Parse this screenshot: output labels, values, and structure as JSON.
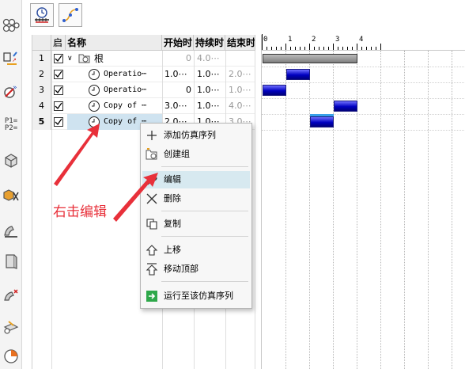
{
  "columns": {
    "enabled": "启",
    "name": "名称",
    "start": "开始时",
    "duration": "持续时",
    "end": "结束时"
  },
  "rows": [
    {
      "num": "1",
      "name": "根",
      "start": "0",
      "duration": "4.0⋯",
      "end": ""
    },
    {
      "num": "2",
      "name": "Operatio⋯",
      "start": "1.0⋯",
      "duration": "1.0⋯",
      "end": "2.0⋯"
    },
    {
      "num": "3",
      "name": "Operatio⋯",
      "start": "0",
      "duration": "1.0⋯",
      "end": "1.0⋯"
    },
    {
      "num": "4",
      "name": "Copy of ⋯",
      "start": "3.0⋯",
      "duration": "1.0⋯",
      "end": "4.0⋯"
    },
    {
      "num": "5",
      "name": "Copy of ⋯",
      "start": "2.0⋯",
      "duration": "1.0⋯",
      "end": "3.0⋯"
    }
  ],
  "ruler_labels": [
    "0",
    "1",
    "2",
    "3",
    "4"
  ],
  "context_menu": {
    "add_sequence": "添加仿真序列",
    "create_group": "创建组",
    "edit": "编辑",
    "delete": "删除",
    "copy": "复制",
    "move_up": "上移",
    "move_top": "移动顶部",
    "run_to": "运行至该仿真序列"
  },
  "left_toolbar": {
    "p_text_1": "P1=",
    "p_text_2": "P2="
  },
  "annotation": {
    "text": "右击编辑"
  },
  "colors": {
    "accent_red": "#e8303a",
    "bar_blue": "#0000c0",
    "highlight": "#d7e9f0"
  }
}
